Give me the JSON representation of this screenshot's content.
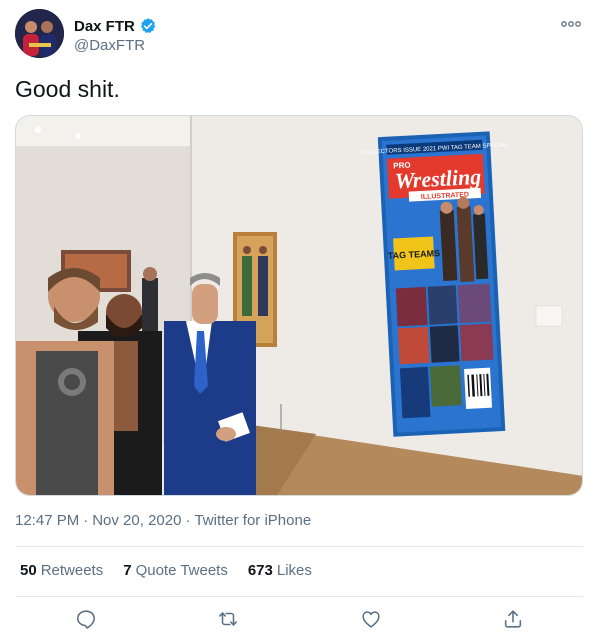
{
  "author": {
    "display_name": "Dax FTR",
    "handle": "@DaxFTR",
    "verified": true,
    "avatar_icon": "avatar"
  },
  "tweet": {
    "text": "Good shit."
  },
  "media": {
    "magazine_brand_top": "PRO",
    "magazine_title": "Wrestling",
    "magazine_subtitle": "ILLUSTRATED",
    "magazine_banner": "TAG TEAMS",
    "magazine_tagline": "COLLECTORS ISSUE  2021 PWI TAG TEAM SPECIAL"
  },
  "meta": {
    "time": "12:47 PM",
    "date": "Nov 20, 2020",
    "separator": "·",
    "source": "Twitter for iPhone"
  },
  "stats": {
    "retweets_count": "50",
    "retweets_label": "Retweets",
    "quotes_count": "7",
    "quotes_label": "Quote Tweets",
    "likes_count": "673",
    "likes_label": "Likes"
  },
  "colors": {
    "brand_blue": "#1da1f2",
    "text_primary": "#0f1419",
    "text_secondary": "#5b7083",
    "divider": "#e1e8ed"
  },
  "icons": {
    "verified": "verified-badge-icon",
    "more": "more-icon",
    "reply": "reply-icon",
    "retweet": "retweet-icon",
    "like": "like-icon",
    "share": "share-icon"
  }
}
